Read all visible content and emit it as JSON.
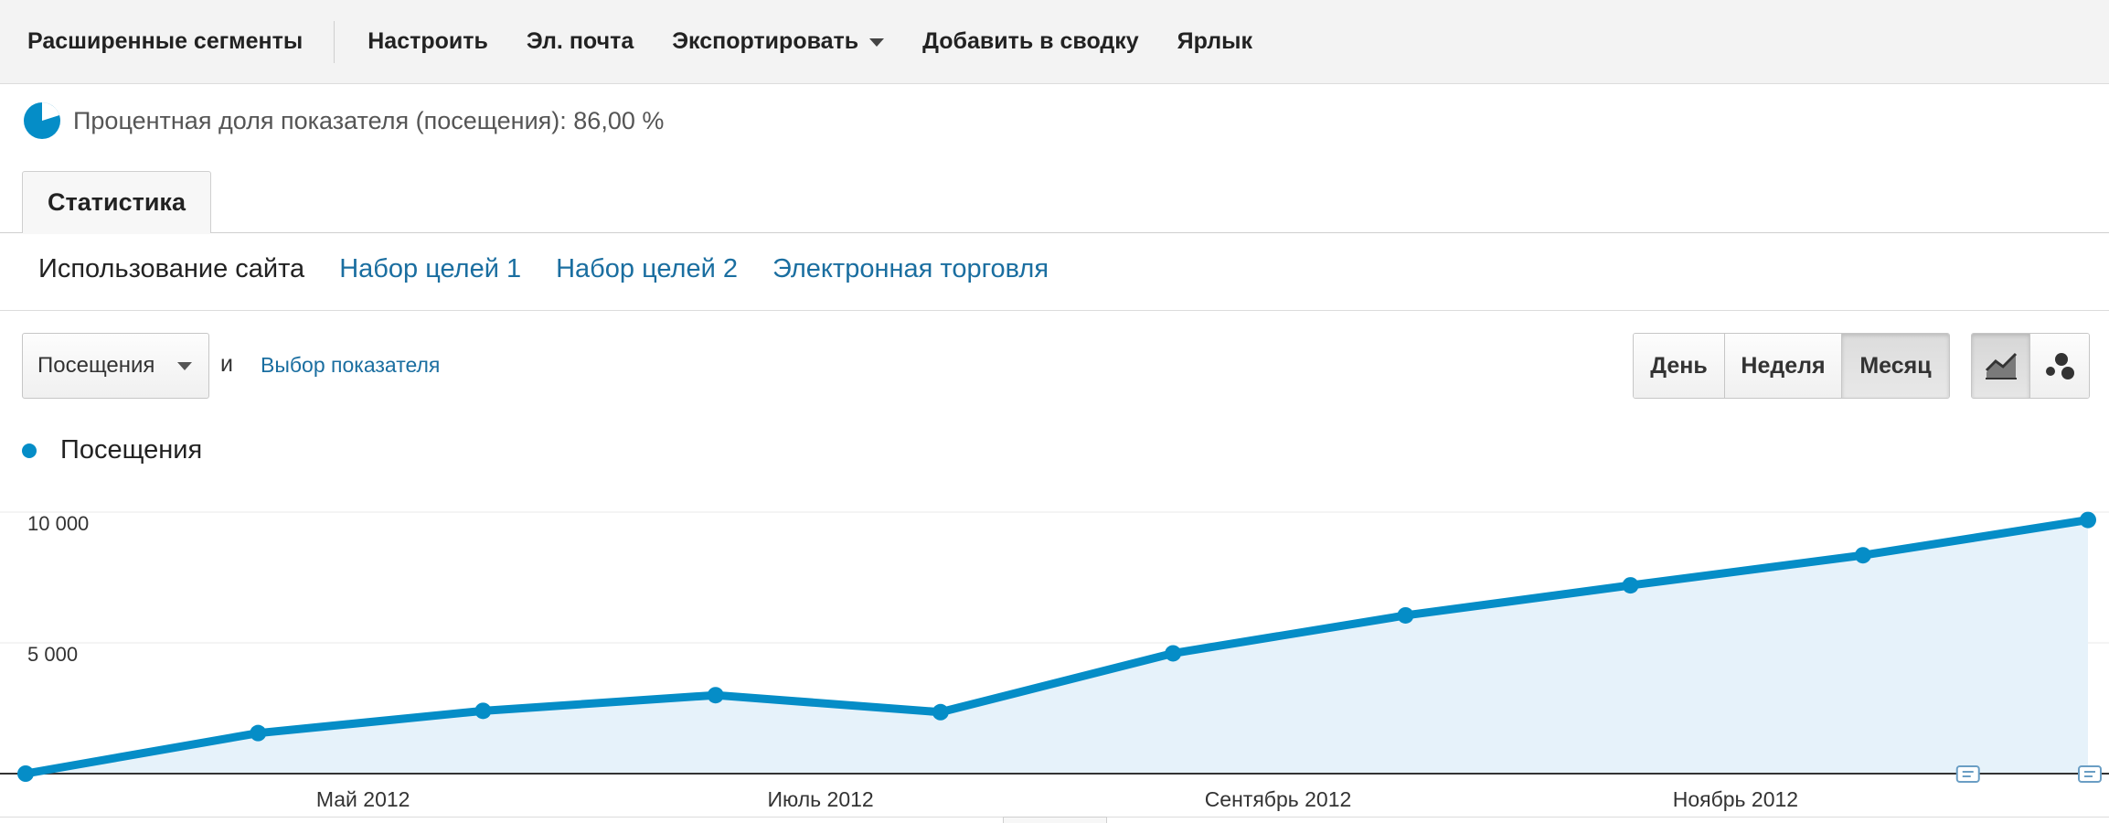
{
  "toolbar": {
    "advanced_segments": "Расширенные сегменты",
    "customize": "Настроить",
    "email": "Эл. почта",
    "export": "Экспортировать",
    "add_to_dashboard": "Добавить в сводку",
    "shortcut": "Ярлык"
  },
  "sampling": {
    "text": "Процентная доля показателя (посещения): 86,00 %",
    "icon": "pie-chart-icon"
  },
  "tabs": [
    {
      "label": "Статистика",
      "active": true
    }
  ],
  "subnav": {
    "items": [
      {
        "label": "Использование сайта",
        "active": true
      },
      {
        "label": "Набор целей 1",
        "active": false
      },
      {
        "label": "Набор целей 2",
        "active": false
      },
      {
        "label": "Электронная торговля",
        "active": false
      }
    ]
  },
  "controls": {
    "metric_selected": "Посещения",
    "and_text": "и",
    "choose_metric": "Выбор показателя",
    "periods": [
      {
        "label": "День",
        "selected": false
      },
      {
        "label": "Неделя",
        "selected": false
      },
      {
        "label": "Месяц",
        "selected": true
      }
    ],
    "view_modes": [
      {
        "icon": "line-chart-icon",
        "selected": true
      },
      {
        "icon": "motion-chart-icon",
        "selected": false
      }
    ]
  },
  "legend": {
    "label": "Посещения",
    "color": "#058dc7"
  },
  "chart_data": {
    "type": "area",
    "x": [
      "2012-03",
      "2012-04",
      "2012-05",
      "2012-06",
      "2012-07",
      "2012-08",
      "2012-09",
      "2012-10",
      "2012-11",
      "2012-12"
    ],
    "series": [
      {
        "name": "Посещения",
        "values": [
          0,
          1550,
          2400,
          3000,
          2350,
          4600,
          6050,
          7200,
          8350,
          9700
        ]
      }
    ],
    "x_tick_labels": [
      {
        "x": "2012-04-15",
        "label": "Май 2012"
      },
      {
        "x": "2012-06-15",
        "label": "Июль 2012"
      },
      {
        "x": "2012-08-15",
        "label": "Сентябрь 2012"
      },
      {
        "x": "2012-10-15",
        "label": "Ноябрь 2012"
      }
    ],
    "y_ticks": [
      {
        "value": 10000,
        "label": "10 000"
      },
      {
        "value": 5000,
        "label": "5 000"
      }
    ],
    "ylim": [
      0,
      10000
    ],
    "grid": true,
    "line_color": "#058dc7",
    "fill_color": "#e6f2fa",
    "annotation_icon": "annotation-icon"
  }
}
